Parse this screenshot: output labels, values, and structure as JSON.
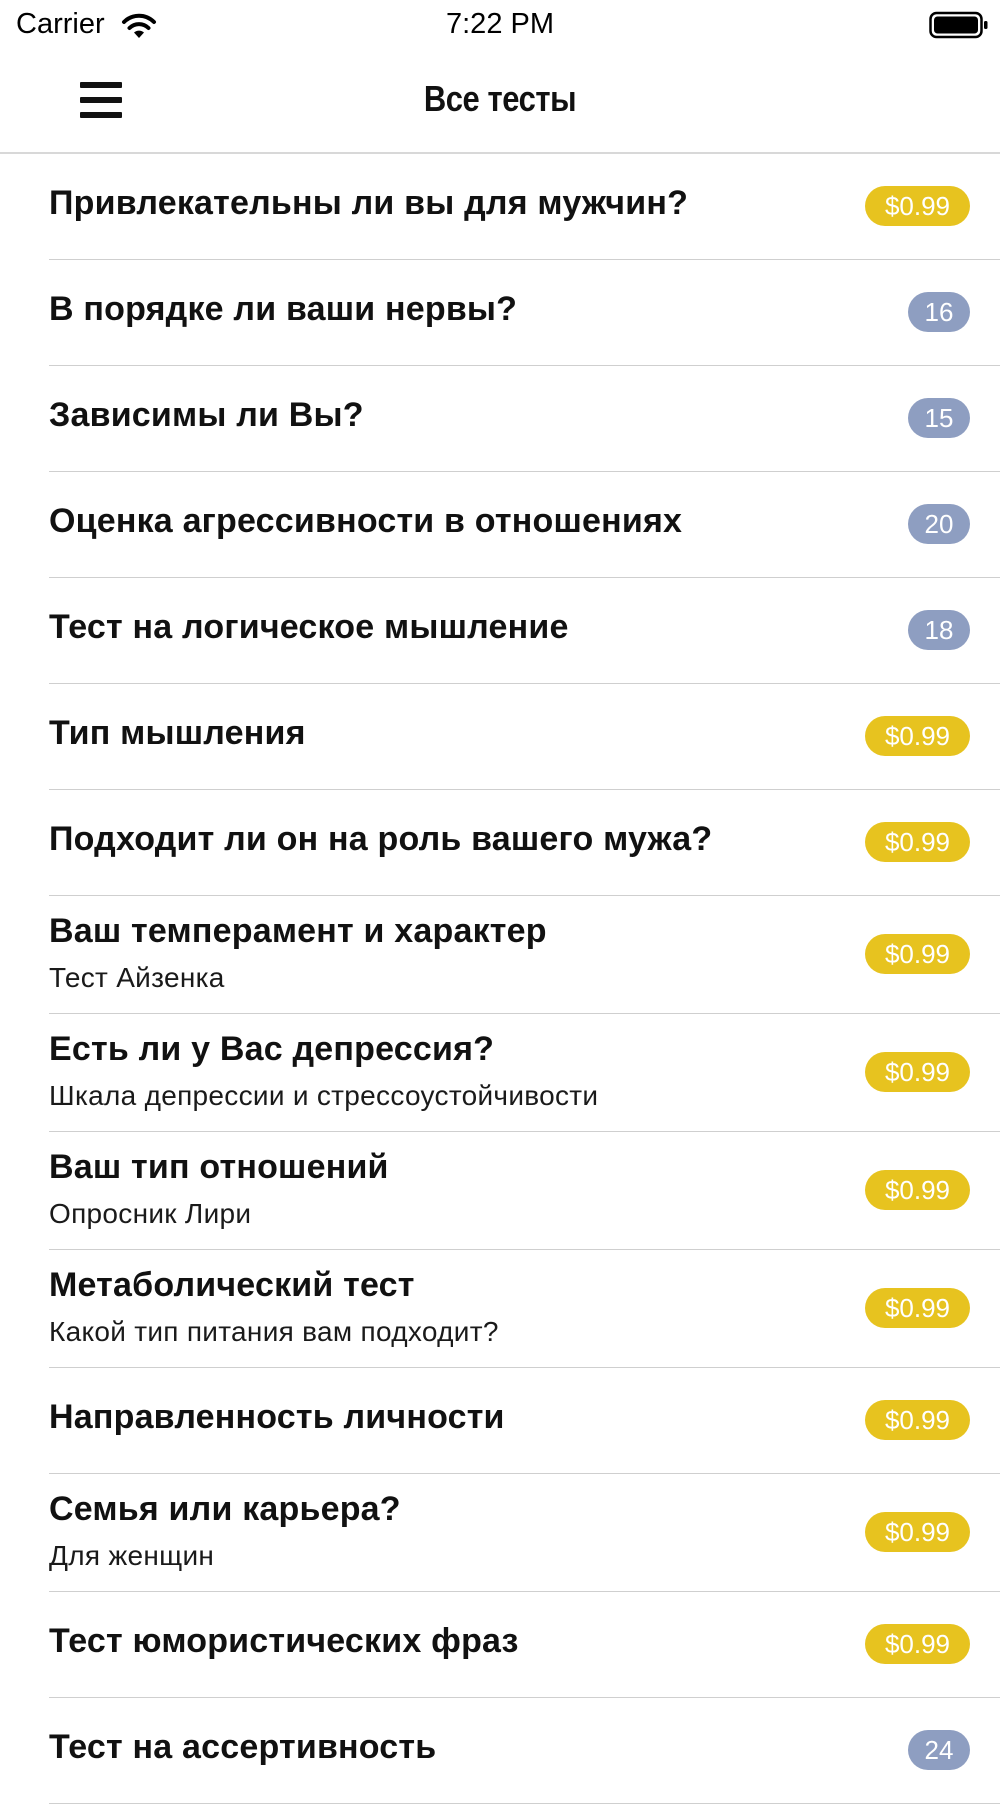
{
  "status_bar": {
    "carrier": "Carrier",
    "time": "7:22 PM",
    "wifi_icon": "wifi-icon",
    "battery_icon": "battery-icon"
  },
  "nav": {
    "title": "Все тесты",
    "menu_icon": "hamburger-menu-icon"
  },
  "colors": {
    "price_badge": "#e7c31f",
    "count_badge": "#8e9ec1",
    "separator": "#cfcfcf"
  },
  "tests": [
    {
      "title": "Привлекательны ли вы для мужчин?",
      "subtitle": "",
      "badge": "$0.99",
      "badge_type": "price"
    },
    {
      "title": "В порядке ли ваши нервы?",
      "subtitle": "",
      "badge": "16",
      "badge_type": "count"
    },
    {
      "title": "Зависимы ли Вы?",
      "subtitle": "",
      "badge": "15",
      "badge_type": "count"
    },
    {
      "title": "Оценка агрессивности в отношениях",
      "subtitle": "",
      "badge": "20",
      "badge_type": "count"
    },
    {
      "title": "Тест на логическое мышление",
      "subtitle": "",
      "badge": "18",
      "badge_type": "count"
    },
    {
      "title": "Тип мышления",
      "subtitle": "",
      "badge": "$0.99",
      "badge_type": "price"
    },
    {
      "title": "Подходит ли он на роль вашего мужа?",
      "subtitle": "",
      "badge": "$0.99",
      "badge_type": "price"
    },
    {
      "title": "Ваш темперамент и характер",
      "subtitle": "Тест Айзенка",
      "badge": "$0.99",
      "badge_type": "price"
    },
    {
      "title": "Есть ли у Вас депрессия?",
      "subtitle": "Шкала депрессии и стрессоустойчивости",
      "badge": "$0.99",
      "badge_type": "price"
    },
    {
      "title": "Ваш тип отношений",
      "subtitle": "Опросник Лири",
      "badge": "$0.99",
      "badge_type": "price"
    },
    {
      "title": "Метаболический тест",
      "subtitle": "Какой тип питания вам подходит?",
      "badge": "$0.99",
      "badge_type": "price"
    },
    {
      "title": "Направленность личности",
      "subtitle": "",
      "badge": "$0.99",
      "badge_type": "price"
    },
    {
      "title": "Семья или карьера?",
      "subtitle": "Для женщин",
      "badge": "$0.99",
      "badge_type": "price"
    },
    {
      "title": "Тест юмористических фраз",
      "subtitle": "",
      "badge": "$0.99",
      "badge_type": "price"
    },
    {
      "title": "Тест на ассертивность",
      "subtitle": "",
      "badge": "24",
      "badge_type": "count"
    }
  ]
}
